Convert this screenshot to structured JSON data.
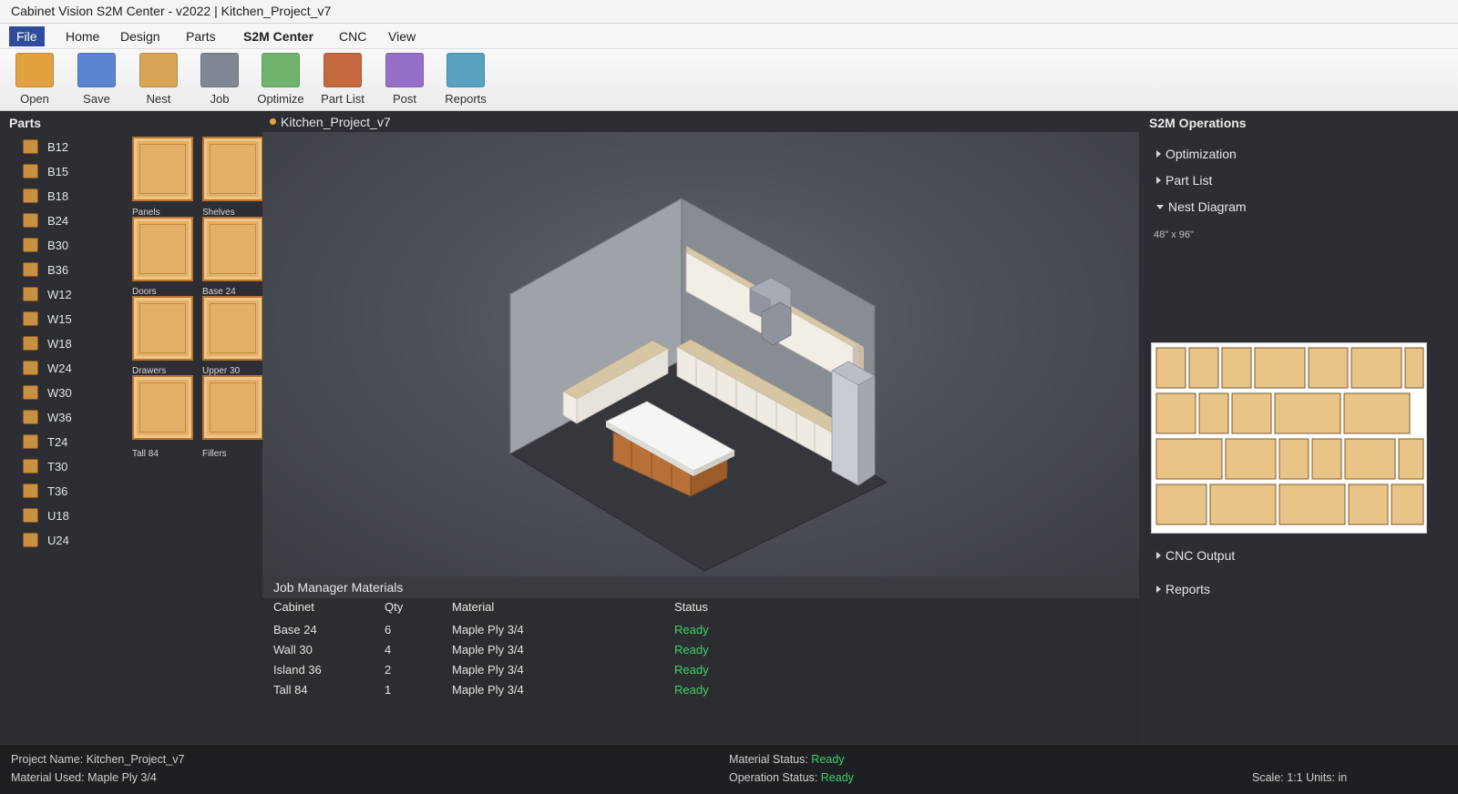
{
  "window": {
    "title": "Cabinet Vision S2M Center - v2022 | Kitchen_Project_v7"
  },
  "menu": [
    "File",
    "Home",
    "Design",
    "Parts",
    "S2M Center",
    "CNC",
    "View"
  ],
  "toolbar": [
    {
      "label": "Open",
      "color": "#e1a13f"
    },
    {
      "label": "Save",
      "color": "#5b86cf"
    },
    {
      "label": "Nest",
      "color": "#d6a555"
    },
    {
      "label": "Job",
      "color": "#7e8792"
    },
    {
      "label": "Optimize",
      "color": "#6fb36d"
    },
    {
      "label": "Part List",
      "color": "#c4693f"
    },
    {
      "label": "Post",
      "color": "#9570c9"
    },
    {
      "label": "Reports",
      "color": "#58a1bf"
    }
  ],
  "parts_panel": {
    "title": "Parts",
    "items": [
      "B12",
      "B15",
      "B18",
      "B24",
      "B30",
      "B36",
      "W12",
      "W15",
      "W18",
      "W24",
      "W30",
      "W36",
      "T24",
      "T30",
      "T36",
      "U18",
      "U24"
    ],
    "thumbnails": [
      "Panels",
      "Shelves",
      "Doors",
      "Base 24",
      "Drawers",
      "Upper 30",
      "Tall 84",
      "Fillers"
    ]
  },
  "viewport": {
    "tab_title": "Kitchen_Project_v7"
  },
  "job_manager": {
    "title": "Job Manager Materials",
    "columns": [
      "Cabinet",
      "Qty",
      "Material",
      "Status"
    ],
    "rows": [
      [
        "Base 24",
        "6",
        "Maple Ply 3/4",
        "Ready"
      ],
      [
        "Wall 30",
        "4",
        "Maple Ply 3/4",
        "Ready"
      ],
      [
        "Island 36",
        "2",
        "Maple Ply 3/4",
        "Ready"
      ],
      [
        "Tall 84",
        "1",
        "Maple Ply 3/4",
        "Ready"
      ]
    ]
  },
  "operations": {
    "title": "S2M Operations",
    "sections": [
      "Optimization",
      "Part List",
      "Nest Diagram",
      "CNC Output",
      "Reports"
    ],
    "sheet_size": "48\" x 96\""
  },
  "status": {
    "project_name_label": "Project Name:",
    "project_name": "Kitchen_Project_v7",
    "material_used_label": "Material Used:",
    "material_used": "Maple Ply 3/4",
    "material_status_label": "Material Status:",
    "material_status": "Ready",
    "operation_status_label": "Operation Status:",
    "operation_status": "Ready",
    "scale": "Scale: 1:1 Units: in"
  },
  "colors": {
    "accent": "#2f4c9b",
    "ready": "#3fcf6a",
    "part_swatch": "#c98f42",
    "nest_part": "#e9c487"
  }
}
